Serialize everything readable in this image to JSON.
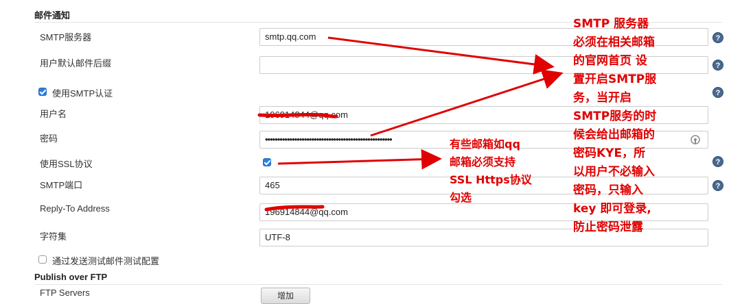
{
  "sections": {
    "mail": "邮件通知",
    "ftp": "Publish over FTP"
  },
  "fields": {
    "smtp_server": {
      "label": "SMTP服务器",
      "value": "smtp.qq.com"
    },
    "default_suffix": {
      "label": "用户默认邮件后缀",
      "value": ""
    },
    "use_smtp_auth": {
      "label": "使用SMTP认证",
      "checked": true
    },
    "username": {
      "label": "用户名",
      "value": "196914844@qq.com"
    },
    "password": {
      "label": "密码",
      "value": "••••••••••••••••••••••••••••••••••••••••••••••••••••"
    },
    "use_ssl": {
      "label": "使用SSL协议",
      "checked": true
    },
    "smtp_port": {
      "label": "SMTP端口",
      "value": "465"
    },
    "reply_to": {
      "label": "Reply-To Address",
      "value": "196914844@qq.com"
    },
    "charset": {
      "label": "字符集",
      "value": "UTF-8"
    },
    "test_config": {
      "label": "通过发送测试邮件测试配置",
      "checked": false
    },
    "ftp_servers": {
      "label": "FTP Servers",
      "button": "增加"
    }
  },
  "help_glyph": "?",
  "annotations": {
    "smtp_note": [
      "SMTP 服务器",
      "必须在相关邮箱",
      "的官网首页 设",
      "置开启SMTP服",
      "务，当开启",
      "SMTP服务的时",
      "候会给出邮箱的",
      "密码KYE，所",
      "以用户不必输入",
      "密码，只输入",
      "key 即可登录,",
      "防止密码泄露"
    ],
    "ssl_note": [
      "有些邮箱如qq",
      "邮箱必须支持",
      "SSL Https协议",
      "勾选"
    ],
    "color": "#e00000"
  },
  "icons": {
    "help": "question-circle-icon",
    "password_toggle": "key-toggle-icon"
  }
}
